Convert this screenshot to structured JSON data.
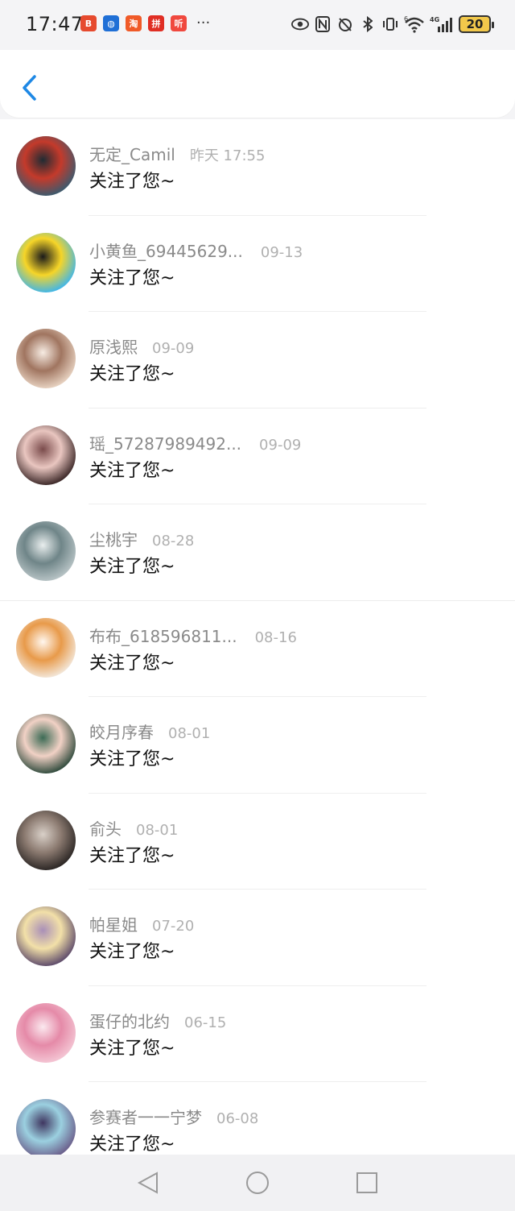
{
  "status": {
    "time": "17:47",
    "app_badges": [
      {
        "label": "B",
        "color": "#e64a2e"
      },
      {
        "label": "◍",
        "color": "#1f6fd6"
      },
      {
        "label": "淘",
        "color": "#f05a28"
      },
      {
        "label": "拼",
        "color": "#e02e24"
      },
      {
        "label": "听",
        "color": "#f0483e"
      }
    ],
    "more": "···",
    "network_label": "4G",
    "wifi_label": "6",
    "battery": "20"
  },
  "header": {
    "back_icon": "chevron-left-icon"
  },
  "follow_list": [
    {
      "name": "无定_Camil",
      "date": "昨天 17:55",
      "message": "关注了您~",
      "avatar_colors": [
        "#3b5a6e",
        "#c43a2b",
        "#1f2b33"
      ]
    },
    {
      "name": "小黄鱼_69445629...",
      "date": "09-13",
      "message": "关注了您~",
      "avatar_colors": [
        "#3fb6ea",
        "#f6d528",
        "#1a1a1a"
      ]
    },
    {
      "name": "原浅熙",
      "date": "09-09",
      "message": "关注了您~",
      "avatar_colors": [
        "#e8d3c2",
        "#a07560",
        "#f7ece3"
      ]
    },
    {
      "name": "瑶_57287989492...",
      "date": "09-09",
      "message": "关注了您~",
      "avatar_colors": [
        "#3a2626",
        "#e9c6c0",
        "#7a4b4b"
      ]
    },
    {
      "name": "尘桃宇",
      "date": "08-28",
      "message": "关注了您~",
      "avatar_colors": [
        "#b8c4c6",
        "#6f8588",
        "#e9eeee"
      ]
    },
    {
      "name": "布布_618596811...",
      "date": "08-16",
      "message": "关注了您~",
      "avatar_colors": [
        "#f3e7d9",
        "#e89a4a",
        "#fff7ef"
      ]
    },
    {
      "name": "皎月序春",
      "date": "08-01",
      "message": "关注了您~",
      "avatar_colors": [
        "#2f4a3c",
        "#f1d1c5",
        "#3c6b55"
      ]
    },
    {
      "name": "俞头",
      "date": "08-01",
      "message": "关注了您~",
      "avatar_colors": [
        "#2b2624",
        "#8b7a70",
        "#d9d0c8"
      ]
    },
    {
      "name": "帕星姐",
      "date": "07-20",
      "message": "关注了您~",
      "avatar_colors": [
        "#5d4a6a",
        "#f2e0a8",
        "#a98fb8"
      ]
    },
    {
      "name": "蛋仔的北约",
      "date": "06-15",
      "message": "关注了您~",
      "avatar_colors": [
        "#f4c6d4",
        "#e58aa8",
        "#fbe9ef"
      ]
    },
    {
      "name": "参赛者一一宁梦",
      "date": "06-08",
      "message": "关注了您~",
      "avatar_colors": [
        "#6a5d8a",
        "#9bd0e0",
        "#3f3660"
      ]
    }
  ],
  "nav": {
    "back_icon": "triangle-back-icon",
    "home_icon": "circle-home-icon",
    "recents_icon": "square-recents-icon"
  },
  "colors": {
    "accent": "#1e88e5",
    "name_gray": "#8a8a8a",
    "date_gray": "#b0b0b0"
  }
}
